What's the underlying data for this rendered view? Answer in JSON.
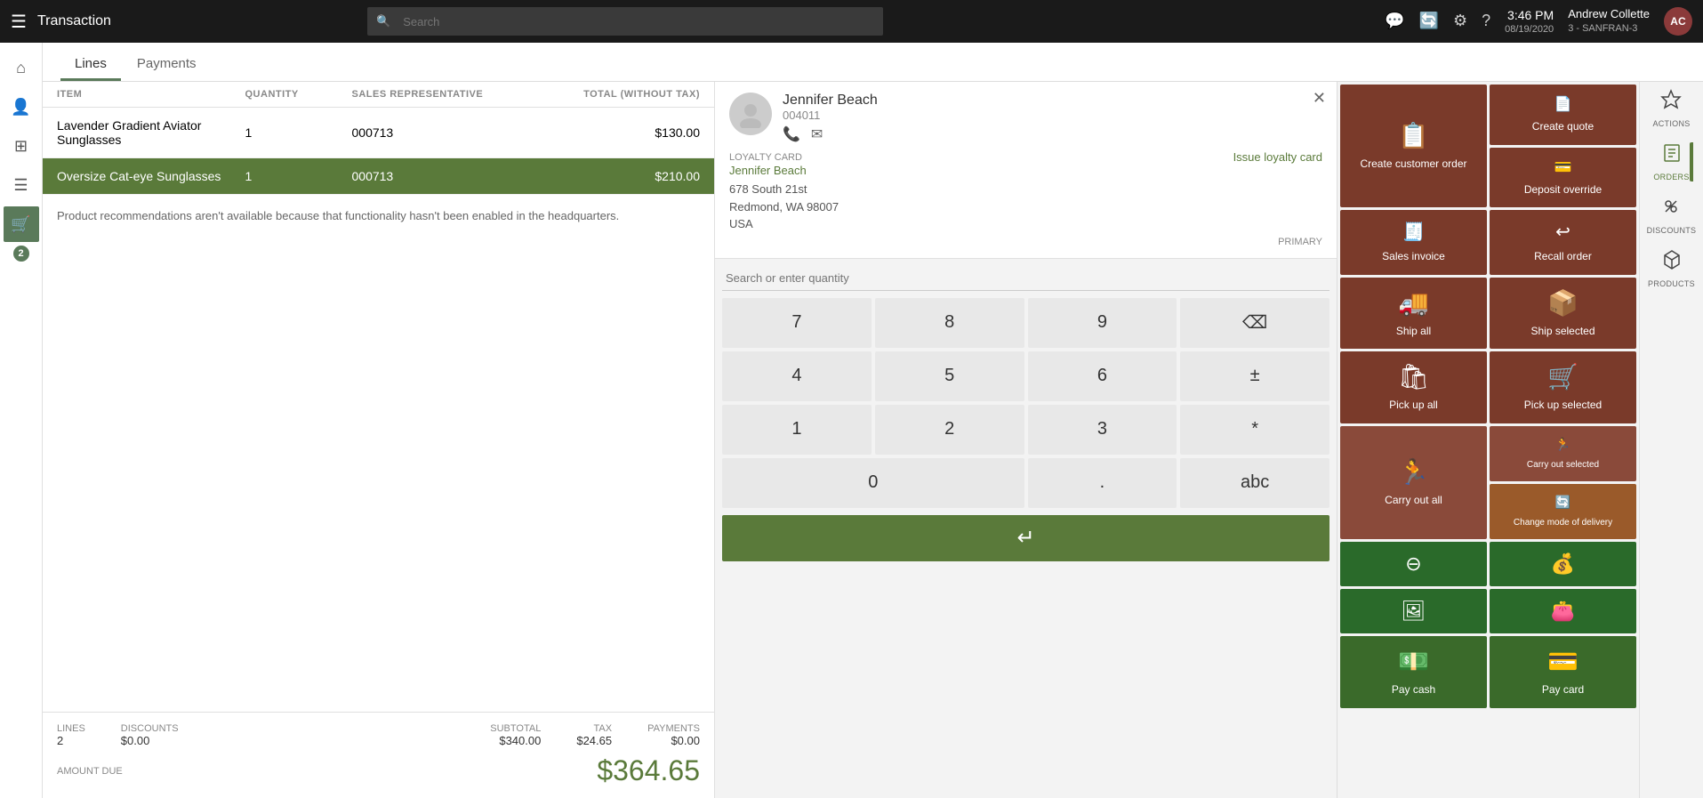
{
  "topbar": {
    "menu_icon": "☰",
    "title": "Transaction",
    "search_placeholder": "Search",
    "time": "3:46 PM",
    "date": "08/19/2020",
    "user_name": "Andrew Collette",
    "user_store": "3 - SANFRAN-3",
    "avatar_initials": "AC"
  },
  "tabs": [
    {
      "id": "lines",
      "label": "Lines",
      "active": true
    },
    {
      "id": "payments",
      "label": "Payments",
      "active": false
    }
  ],
  "table": {
    "headers": [
      "ITEM",
      "QUANTITY",
      "SALES REPRESENTATIVE",
      "TOTAL (WITHOUT TAX)"
    ],
    "rows": [
      {
        "item": "Lavender Gradient Aviator Sunglasses",
        "quantity": "1",
        "rep": "000713",
        "total": "$130.00",
        "selected": false
      },
      {
        "item": "Oversize Cat-eye Sunglasses",
        "quantity": "1",
        "rep": "000713",
        "total": "$210.00",
        "selected": true
      }
    ]
  },
  "recommendation_msg": "Product recommendations aren't available because that functionality hasn't been enabled in the headquarters.",
  "totals": {
    "lines_label": "LINES",
    "lines_value": "2",
    "discounts_label": "DISCOUNTS",
    "discounts_value": "$0.00",
    "subtotal_label": "SUBTOTAL",
    "subtotal_value": "$340.00",
    "tax_label": "TAX",
    "tax_value": "$24.65",
    "payments_label": "PAYMENTS",
    "payments_value": "$0.00",
    "amount_due_label": "AMOUNT DUE",
    "amount_due_value": "$364.65"
  },
  "customer": {
    "name": "Jennifer Beach",
    "id": "004011",
    "address_line1": "678 South 21st",
    "address_line2": "Redmond, WA 98007",
    "address_line3": "USA",
    "loyalty_label": "LOYALTY CARD",
    "loyalty_link": "Issue loyalty card",
    "loyalty_name": "Jennifer Beach",
    "primary_label": "PRIMARY"
  },
  "numpad": {
    "search_placeholder": "Search or enter quantity",
    "buttons": [
      "7",
      "8",
      "9",
      "⌫",
      "4",
      "5",
      "6",
      "±",
      "1",
      "2",
      "3",
      "*",
      "0",
      ".",
      "abc"
    ],
    "enter_icon": "↵"
  },
  "action_tiles": {
    "top_group": [
      {
        "id": "create-customer-order",
        "label": "Create customer order",
        "icon": "📋",
        "color": "dark-brown"
      },
      {
        "id": "create-quote",
        "label": "Create quote",
        "icon": "📄",
        "color": "dark-brown"
      },
      {
        "id": "deposit-override",
        "label": "Deposit override",
        "icon": "💳",
        "color": "dark-brown"
      },
      {
        "id": "sales-invoice",
        "label": "Sales invoice",
        "icon": "🧾",
        "color": "dark-brown"
      },
      {
        "id": "recall-order",
        "label": "Recall order",
        "icon": "↩",
        "color": "dark-brown"
      }
    ],
    "delivery_tiles": [
      {
        "id": "ship-all",
        "label": "Ship all",
        "icon": "🚚"
      },
      {
        "id": "ship-selected",
        "label": "Ship selected",
        "icon": "📦"
      },
      {
        "id": "pick-up-all",
        "label": "Pick up all",
        "icon": "🛍"
      },
      {
        "id": "pick-up-selected",
        "label": "Pick up selected",
        "icon": "🛒"
      },
      {
        "id": "carry-out-all",
        "label": "Carry out all",
        "icon": "🏃"
      },
      {
        "id": "carry-out-selected",
        "label": "Carry out selected",
        "icon": "🏃"
      },
      {
        "id": "change-mode-delivery",
        "label": "Change mode of delivery",
        "icon": "🔄"
      }
    ],
    "payment_tiles": [
      {
        "id": "pay-cash",
        "label": "Pay cash",
        "icon": "💵",
        "color": "green"
      },
      {
        "id": "pay-card",
        "label": "Pay card",
        "icon": "💳",
        "color": "green"
      }
    ],
    "small_tiles": [
      {
        "id": "equal-icon",
        "label": "",
        "icon": "⊖",
        "color": "green"
      },
      {
        "id": "dollar-icon",
        "label": "",
        "icon": "💰",
        "color": "green"
      },
      {
        "id": "card2-icon",
        "label": "",
        "icon": "🖼",
        "color": "green"
      },
      {
        "id": "wallet-icon",
        "label": "",
        "icon": "👛",
        "color": "green"
      }
    ]
  },
  "right_action_bar": [
    {
      "id": "actions",
      "label": "ACTIONS",
      "icon": "⚡"
    },
    {
      "id": "orders",
      "label": "ORDERS",
      "icon": "📋",
      "active": true
    },
    {
      "id": "discounts",
      "label": "DISCOUNTS",
      "icon": "🏷"
    },
    {
      "id": "products",
      "label": "PRODUCTS",
      "icon": "📦"
    }
  ],
  "sidebar_icons": [
    {
      "id": "home",
      "icon": "⌂"
    },
    {
      "id": "people",
      "icon": "👤"
    },
    {
      "id": "grid",
      "icon": "⊞"
    },
    {
      "id": "menu",
      "icon": "☰"
    },
    {
      "id": "cart",
      "icon": "🛒",
      "active": true
    },
    {
      "id": "badge",
      "value": "2"
    }
  ]
}
